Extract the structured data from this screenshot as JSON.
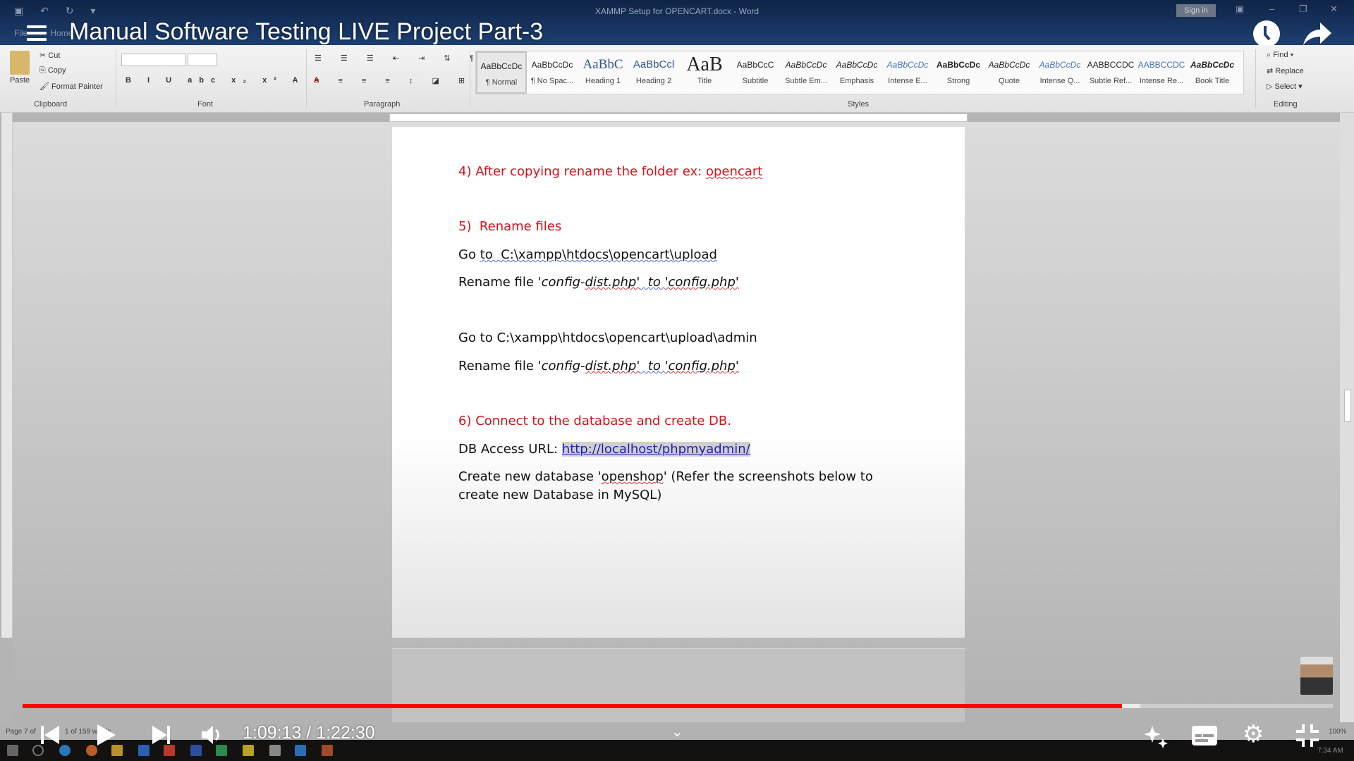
{
  "word": {
    "doc_title": "XAMMP Setup for OPENCART.docx - Word",
    "sign_in": "Sign in",
    "menu_tabs": [
      "File",
      "Home"
    ],
    "clipboard": {
      "paste": "Paste",
      "cut": "Cut",
      "copy": "Copy",
      "format_painter": "Format Painter",
      "label": "Clipboard"
    },
    "font_label": "Font",
    "paragraph_label": "Paragraph",
    "styles_label": "Styles",
    "styles": [
      {
        "preview": "AaBbCcDc",
        "name": "¶ Normal"
      },
      {
        "preview": "AaBbCcDc",
        "name": "¶ No Spac..."
      },
      {
        "preview": "AaBbC",
        "name": "Heading 1"
      },
      {
        "preview": "AaBbCcl",
        "name": "Heading 2"
      },
      {
        "preview": "AaB",
        "name": "Title"
      },
      {
        "preview": "AaBbCcC",
        "name": "Subtitle"
      },
      {
        "preview": "AaBbCcDc",
        "name": "Subtle Em..."
      },
      {
        "preview": "AaBbCcDc",
        "name": "Emphasis"
      },
      {
        "preview": "AaBbCcDc",
        "name": "Intense E..."
      },
      {
        "preview": "AaBbCcDc",
        "name": "Strong"
      },
      {
        "preview": "AaBbCcDc",
        "name": "Quote"
      },
      {
        "preview": "AaBbCcDc",
        "name": "Intense Q..."
      },
      {
        "preview": "AABBCCDC",
        "name": "Subtle Ref..."
      },
      {
        "preview": "AABBCCDC",
        "name": "Intense Re..."
      },
      {
        "preview": "AaBbCcDc",
        "name": "Book Title"
      }
    ],
    "editing": {
      "find": "Find",
      "replace": "Replace",
      "select": "Select",
      "label": "Editing"
    },
    "status": {
      "page": "Page 7 of",
      "words": "1 of 159 words",
      "zoom": "100%"
    },
    "clock": "7:34 AM"
  },
  "document": {
    "step4": "4) After copying rename the folder ex: ",
    "step4_link": "opencart",
    "step5": "5)  Rename files",
    "goto1_a": "Go ",
    "goto1_b": "to  C:\\xampp\\htdocs\\opencart\\upload",
    "rename_a": "Rename file ",
    "rename_b": "'config-",
    "rename_c": "dist.php'",
    "rename_d": "  to ",
    "rename_e": "'config.php'",
    "goto2": "Go to C:\\xampp\\htdocs\\opencart\\upload\\admin",
    "step6": "6) Connect to the database and create DB.",
    "db_label": "DB Access URL: ",
    "db_url": "http://localhost/phpmyadmin/",
    "create_a": "Create new database '",
    "create_b": "openshop",
    "create_c": "' (Refer the screenshots below to",
    "create_d": "create new Database in MySQL)"
  },
  "player": {
    "video_title": "Manual Software Testing LIVE Project Part-3",
    "current_time": "1:09:13",
    "duration": "1:22:30",
    "time_display": "1:09:13 / 1:22:30",
    "played_fraction": 0.839,
    "buffered_fraction": 0.853,
    "accent": "#ff0000"
  }
}
